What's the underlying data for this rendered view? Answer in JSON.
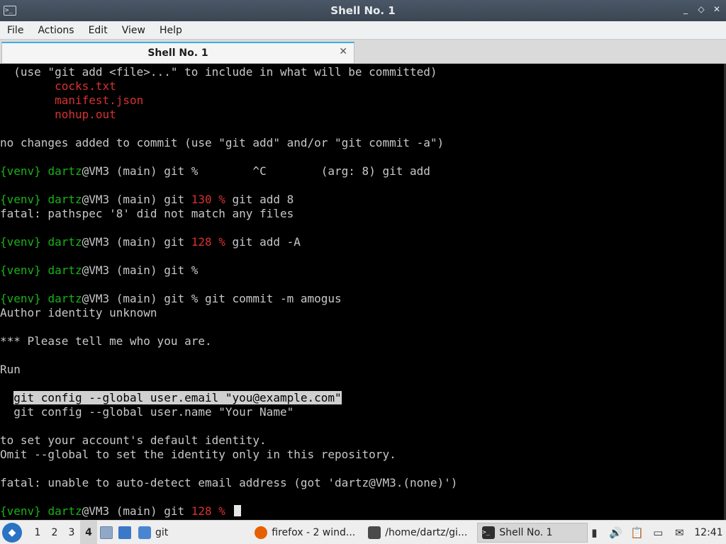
{
  "window": {
    "title": "Shell No. 1",
    "buttons": [
      "_",
      "◇",
      "✕"
    ]
  },
  "menubar": [
    "File",
    "Actions",
    "Edit",
    "View",
    "Help"
  ],
  "tab": {
    "label": "Shell No. 1",
    "close": "✕"
  },
  "terminal": {
    "lines": [
      [
        {
          "t": "  (use \"git add <file>...\" to include in what will be committed)"
        }
      ],
      [
        {
          "t": "        "
        },
        {
          "t": "cocks.txt",
          "c": "r"
        }
      ],
      [
        {
          "t": "        "
        },
        {
          "t": "manifest.json",
          "c": "r"
        }
      ],
      [
        {
          "t": "        "
        },
        {
          "t": "nohup.out",
          "c": "r"
        }
      ],
      [],
      [
        {
          "t": "no changes added to commit (use \"git add\" and/or \"git commit -a\")"
        }
      ],
      [],
      [
        {
          "t": "{venv} ",
          "c": "g"
        },
        {
          "t": "dartz",
          "c": "g"
        },
        {
          "t": "@VM3 (main) git %        ^C        (arg: 8) git add"
        }
      ],
      [],
      [
        {
          "t": "{venv} ",
          "c": "g"
        },
        {
          "t": "dartz",
          "c": "g"
        },
        {
          "t": "@VM3 (main) git "
        },
        {
          "t": "130 %",
          "c": "r"
        },
        {
          "t": " git add 8"
        }
      ],
      [
        {
          "t": "fatal: pathspec '8' did not match any files"
        }
      ],
      [],
      [
        {
          "t": "{venv} ",
          "c": "g"
        },
        {
          "t": "dartz",
          "c": "g"
        },
        {
          "t": "@VM3 (main) git "
        },
        {
          "t": "128 %",
          "c": "r"
        },
        {
          "t": " git add -A"
        }
      ],
      [],
      [
        {
          "t": "{venv} ",
          "c": "g"
        },
        {
          "t": "dartz",
          "c": "g"
        },
        {
          "t": "@VM3 (main) git %"
        }
      ],
      [],
      [
        {
          "t": "{venv} ",
          "c": "g"
        },
        {
          "t": "dartz",
          "c": "g"
        },
        {
          "t": "@VM3 (main) git % git commit -m amogus"
        }
      ],
      [
        {
          "t": "Author identity unknown"
        }
      ],
      [],
      [
        {
          "t": "*** Please tell me who you are."
        }
      ],
      [],
      [
        {
          "t": "Run"
        }
      ],
      [],
      [
        {
          "t": "  "
        },
        {
          "t": "git config --global user.email \"you@example.com\"",
          "c": "hl"
        }
      ],
      [
        {
          "t": "  git config --global user.name \"Your Name\""
        }
      ],
      [],
      [
        {
          "t": "to set your account's default identity."
        }
      ],
      [
        {
          "t": "Omit --global to set the identity only in this repository."
        }
      ],
      [],
      [
        {
          "t": "fatal: unable to auto-detect email address (got 'dartz@VM3.(none)')"
        }
      ],
      [],
      [
        {
          "t": "{venv} ",
          "c": "g"
        },
        {
          "t": "dartz",
          "c": "g"
        },
        {
          "t": "@VM3 (main) git "
        },
        {
          "t": "128 %",
          "c": "r"
        },
        {
          "t": " "
        }
      ]
    ]
  },
  "taskbar": {
    "workspaces": [
      "1",
      "2",
      "3",
      "4"
    ],
    "active_workspace": "4",
    "quick_folder_label": "git",
    "tasks": [
      {
        "label": "firefox - 2 wind...",
        "icon": "firefox-icon",
        "color": "#e66000"
      },
      {
        "label": "/home/dartz/gi...",
        "icon": "editor-icon",
        "color": "#4a4a4a"
      },
      {
        "label": "Shell No. 1",
        "icon": "terminal-icon",
        "color": "#2f2f2f"
      }
    ],
    "clock": "12:41"
  }
}
